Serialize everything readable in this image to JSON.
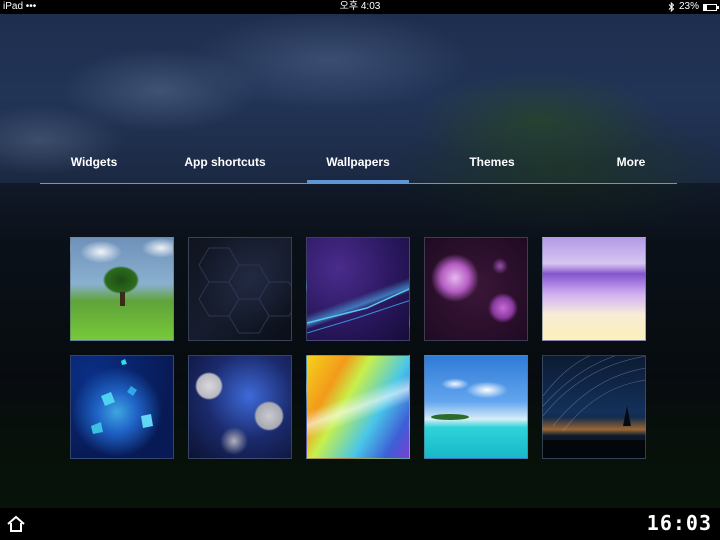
{
  "status_bar": {
    "device": "iPad",
    "signal": "•••",
    "time": "오후 4:03",
    "bluetooth_icon": "bluetooth-icon",
    "battery_percent": "23%",
    "battery_level": 0.23
  },
  "tabs": {
    "items": [
      {
        "label": "Widgets",
        "active": false
      },
      {
        "label": "App shortcuts",
        "active": false
      },
      {
        "label": "Wallpapers",
        "active": true
      },
      {
        "label": "Themes",
        "active": false
      },
      {
        "label": "More",
        "active": false
      }
    ],
    "accent_color": "#5f95d2"
  },
  "wallpapers": [
    {
      "id": "tree"
    },
    {
      "id": "hexagon"
    },
    {
      "id": "purple-lines"
    },
    {
      "id": "purple-spheres"
    },
    {
      "id": "violet-cubes"
    },
    {
      "id": "blue-shards"
    },
    {
      "id": "silver-bokeh"
    },
    {
      "id": "rainbow-light"
    },
    {
      "id": "tropical-island"
    },
    {
      "id": "star-trails"
    }
  ],
  "bottom_bar": {
    "home_icon": "home-icon",
    "clock": "16:03"
  }
}
